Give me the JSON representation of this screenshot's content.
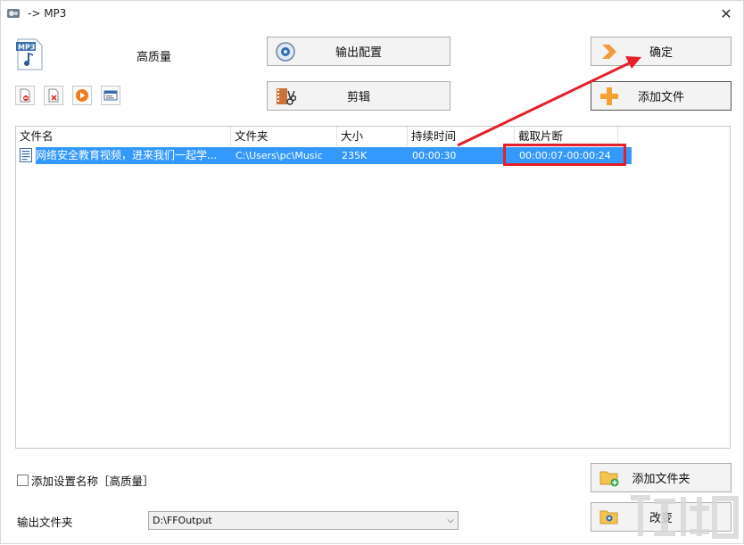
{
  "window": {
    "title": "-> MP3",
    "close_glyph": "✕"
  },
  "profile": {
    "quality_label": "高质量"
  },
  "buttons": {
    "output_config": "输出配置",
    "edit": "剪辑",
    "confirm": "确定",
    "add_file": "添加文件",
    "add_folder": "添加文件夹",
    "change": "改变"
  },
  "toolbar_icons": [
    "remove-file-icon",
    "clear-list-icon",
    "play-icon",
    "file-info-icon"
  ],
  "file_table": {
    "columns": [
      "文件名",
      "文件夹",
      "大小",
      "持续时间",
      "截取片断"
    ],
    "rows": [
      {
        "name": "网络安全教育视频，进来我们一起学...",
        "folder": "C:\\Users\\pc\\Music",
        "size": "235K",
        "duration": "00:00:30",
        "clip": "00:00:07-00:00:24"
      }
    ]
  },
  "options": {
    "add_setting_name_label": "添加设置名称［高质量］",
    "add_setting_name_checked": false
  },
  "output": {
    "label": "输出文件夹",
    "value": "D:\\FFOutput"
  },
  "colors": {
    "selection": "#3399ff",
    "annotation_red": "#e5202a",
    "button_bg": "#f3f3f3"
  }
}
